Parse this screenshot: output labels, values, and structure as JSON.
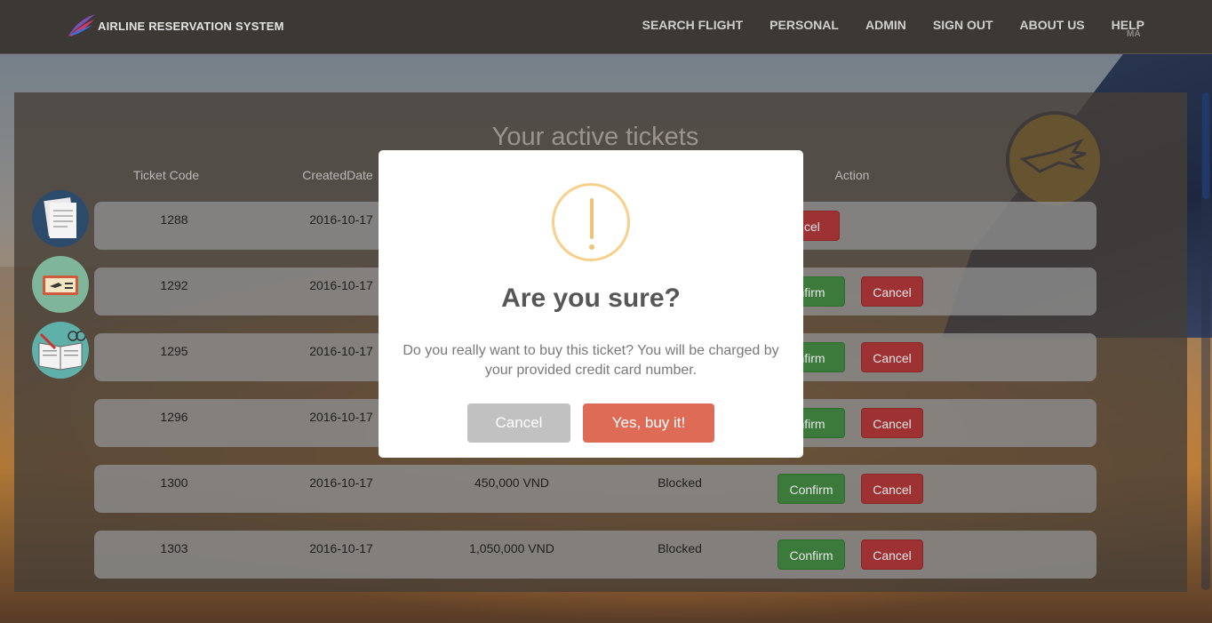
{
  "app": {
    "title": "AIRLINE RESERVATION SYSTEM"
  },
  "nav": {
    "items": [
      "SEARCH FLIGHT",
      "PERSONAL",
      "ADMIN",
      "SIGN OUT",
      "ABOUT US",
      "HELP"
    ],
    "badge": "MA"
  },
  "page": {
    "title": "Your active tickets"
  },
  "table": {
    "headers": {
      "code": "Ticket Code",
      "created": "CreatedDate",
      "action": "Action"
    },
    "rows": [
      {
        "code": "1288",
        "created": "2016-10-17",
        "price": "",
        "status": "",
        "confirm": "",
        "cancel": "ncel"
      },
      {
        "code": "1292",
        "created": "2016-10-17",
        "price": "",
        "status": "",
        "confirm": "nfirm",
        "cancel": "Cancel"
      },
      {
        "code": "1295",
        "created": "2016-10-17",
        "price": "",
        "status": "",
        "confirm": "nfirm",
        "cancel": "Cancel"
      },
      {
        "code": "1296",
        "created": "2016-10-17",
        "price": "",
        "status": "",
        "confirm": "nfirm",
        "cancel": "Cancel"
      },
      {
        "code": "1300",
        "created": "2016-10-17",
        "price": "450,000 VND",
        "status": "Blocked",
        "confirm": "Confirm",
        "cancel": "Cancel"
      },
      {
        "code": "1303",
        "created": "2016-10-17",
        "price": "1,050,000 VND",
        "status": "Blocked",
        "confirm": "Confirm",
        "cancel": "Cancel"
      }
    ]
  },
  "modal": {
    "title": "Are you sure?",
    "text": "Do you really want to buy this ticket? You will be charged by your provided credit card number.",
    "cancel_label": "Cancel",
    "confirm_label": "Yes, buy it!",
    "icon": "warning-icon"
  },
  "colors": {
    "confirm": "#3c7a3c",
    "cancel": "#9e3131",
    "modal_confirm": "#dd6b55",
    "modal_cancel": "#c1c1c1",
    "warning": "#f8d08b"
  },
  "side_icons": [
    "document-icon",
    "ticket-icon",
    "book-icon"
  ]
}
